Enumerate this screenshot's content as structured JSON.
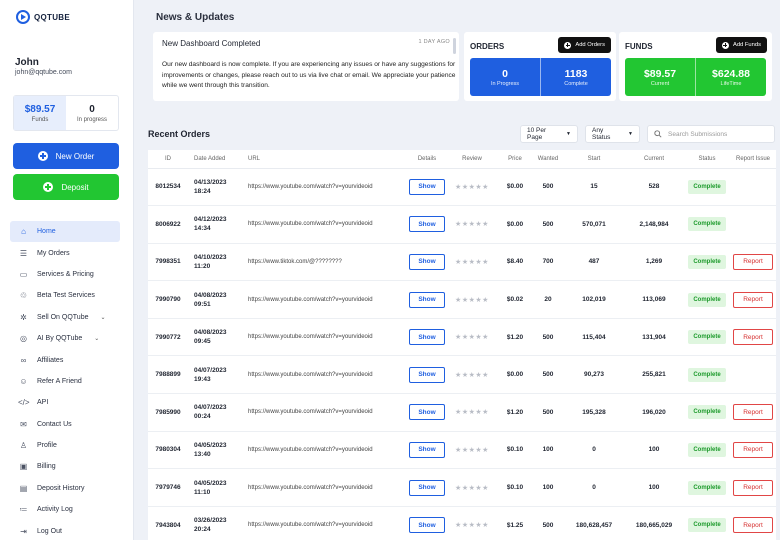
{
  "brand": {
    "name": "QQTUBE",
    "logo_icon": "play-circle-icon",
    "accent": "#1f5fe0",
    "green": "#22c632"
  },
  "user": {
    "name": "John",
    "email": "john@qqtube.com"
  },
  "balance": {
    "funds_value": "$89.57",
    "funds_label": "Funds",
    "progress_value": "0",
    "progress_label": "In progress"
  },
  "sidebar": {
    "new_order": "New Order",
    "deposit": "Deposit",
    "items": [
      {
        "label": "Home",
        "icon": "home-icon",
        "glyph": "⌂",
        "active": true,
        "has_chevron": false
      },
      {
        "label": "My Orders",
        "icon": "list-icon",
        "glyph": "☰",
        "active": false,
        "has_chevron": false
      },
      {
        "label": "Services & Pricing",
        "icon": "price-tag-icon",
        "glyph": "▭",
        "active": false,
        "has_chevron": false
      },
      {
        "label": "Beta Test Services",
        "icon": "flask-icon",
        "glyph": "♲",
        "active": false,
        "has_chevron": false
      },
      {
        "label": "Sell On QQTube",
        "icon": "cog-icon",
        "glyph": "✲",
        "active": false,
        "has_chevron": true
      },
      {
        "label": "AI By QQTube",
        "icon": "ai-chip-icon",
        "glyph": "◎",
        "active": false,
        "has_chevron": true
      },
      {
        "label": "Affiliates",
        "icon": "link-icon",
        "glyph": "∞",
        "active": false,
        "has_chevron": false
      },
      {
        "label": "Refer A Friend",
        "icon": "user-plus-icon",
        "glyph": "☺",
        "active": false,
        "has_chevron": false
      },
      {
        "label": "API",
        "icon": "code-icon",
        "glyph": "</>",
        "active": false,
        "has_chevron": false
      },
      {
        "label": "Contact Us",
        "icon": "chat-icon",
        "glyph": "✉",
        "active": false,
        "has_chevron": false
      },
      {
        "label": "Profile",
        "icon": "user-icon",
        "glyph": "♙",
        "active": false,
        "has_chevron": false
      },
      {
        "label": "Billing",
        "icon": "wallet-icon",
        "glyph": "▣",
        "active": false,
        "has_chevron": false
      },
      {
        "label": "Deposit History",
        "icon": "receipt-icon",
        "glyph": "▤",
        "active": false,
        "has_chevron": false
      },
      {
        "label": "Activity Log",
        "icon": "activity-list-icon",
        "glyph": "≔",
        "active": false,
        "has_chevron": false
      },
      {
        "label": "Log Out",
        "icon": "logout-icon",
        "glyph": "⇥",
        "active": false,
        "has_chevron": false
      }
    ]
  },
  "news": {
    "section_title": "News & Updates",
    "heading": "New Dashboard Completed",
    "time": "1 DAY AGO",
    "body": "Our new dashboard is now complete.  If you are experiencing any issues or have any suggestions for improvements or changes, please reach out to us via live chat or email.  We appreciate your patience while we went through this transition."
  },
  "orders_panel": {
    "title": "ORDERS",
    "button": "Add Orders",
    "in_progress_value": "0",
    "in_progress_label": "In Progress",
    "complete_value": "1183",
    "complete_label": "Complete"
  },
  "funds_panel": {
    "title": "FUNDS",
    "button": "Add Funds",
    "current_value": "$89.57",
    "current_label": "Current",
    "lifetime_value": "$624.88",
    "lifetime_label": "LifeTime"
  },
  "recent": {
    "title": "Recent Orders",
    "per_page": "10 Per Page",
    "status_filter": "Any Status",
    "search_placeholder": "Search Submissions",
    "columns": [
      "ID",
      "Date Added",
      "URL",
      "Details",
      "Review",
      "Price",
      "Wanted",
      "Start",
      "Current",
      "Status",
      "Report Issue"
    ],
    "show_label": "Show",
    "report_label": "Report",
    "stars": "★★★★★",
    "rows": [
      {
        "id": "8012534",
        "date": "04/13/2023",
        "time": "18:24",
        "url": "https://www.youtube.com/watch?v=yourvideoid",
        "price": "$0.00",
        "wanted": "500",
        "start": "15",
        "current": "528",
        "status": "Complete",
        "report": false
      },
      {
        "id": "8006922",
        "date": "04/12/2023",
        "time": "14:34",
        "url": "https://www.youtube.com/watch?v=yourvideoid",
        "price": "$0.00",
        "wanted": "500",
        "start": "570,071",
        "current": "2,148,984",
        "status": "Complete",
        "report": false
      },
      {
        "id": "7998351",
        "date": "04/10/2023",
        "time": "11:20",
        "url": "https://www.tiktok.com/@????????",
        "price": "$8.40",
        "wanted": "700",
        "start": "487",
        "current": "1,269",
        "status": "Complete",
        "report": true
      },
      {
        "id": "7990790",
        "date": "04/08/2023",
        "time": "09:51",
        "url": "https://www.youtube.com/watch?v=yourvideoid",
        "price": "$0.02",
        "wanted": "20",
        "start": "102,019",
        "current": "113,069",
        "status": "Complete",
        "report": true
      },
      {
        "id": "7990772",
        "date": "04/08/2023",
        "time": "09:45",
        "url": "https://www.youtube.com/watch?v=yourvideoid",
        "price": "$1.20",
        "wanted": "500",
        "start": "115,404",
        "current": "131,904",
        "status": "Complete",
        "report": true
      },
      {
        "id": "7988899",
        "date": "04/07/2023",
        "time": "19:43",
        "url": "https://www.youtube.com/watch?v=yourvideoid",
        "price": "$0.00",
        "wanted": "500",
        "start": "90,273",
        "current": "255,821",
        "status": "Complete",
        "report": false
      },
      {
        "id": "7985990",
        "date": "04/07/2023",
        "time": "00:24",
        "url": "https://www.youtube.com/watch?v=yourvideoid",
        "price": "$1.20",
        "wanted": "500",
        "start": "195,328",
        "current": "196,020",
        "status": "Complete",
        "report": true
      },
      {
        "id": "7980304",
        "date": "04/05/2023",
        "time": "13:40",
        "url": "https://www.youtube.com/watch?v=yourvideoid",
        "price": "$0.10",
        "wanted": "100",
        "start": "0",
        "current": "100",
        "status": "Complete",
        "report": true
      },
      {
        "id": "7979746",
        "date": "04/05/2023",
        "time": "11:10",
        "url": "https://www.youtube.com/watch?v=yourvideoid",
        "price": "$0.10",
        "wanted": "100",
        "start": "0",
        "current": "100",
        "status": "Complete",
        "report": true
      },
      {
        "id": "7943804",
        "date": "03/26/2023",
        "time": "20:24",
        "url": "https://www.youtube.com/watch?v=yourvideoid",
        "price": "$1.25",
        "wanted": "500",
        "start": "180,628,457",
        "current": "180,665,029",
        "status": "Complete",
        "report": true
      }
    ]
  }
}
